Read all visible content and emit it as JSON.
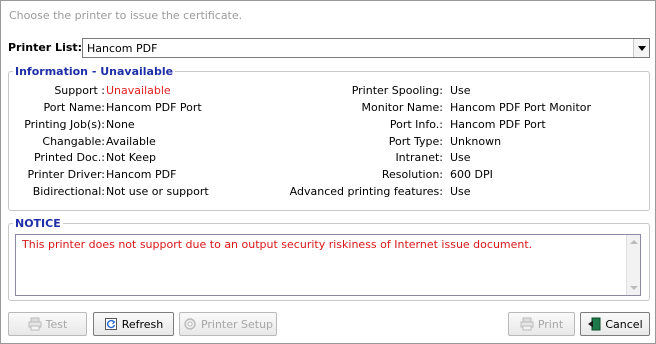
{
  "hint": "Choose the printer to issue the certificate.",
  "printer_list": {
    "label": "Printer List:",
    "selected": "Hancom PDF"
  },
  "information": {
    "legend": "Information - Unavailable",
    "left": [
      {
        "key": "Support :",
        "value": "Unavailable"
      },
      {
        "key": "Port Name:",
        "value": "Hancom PDF Port"
      },
      {
        "key": "Printing Job(s):",
        "value": "None"
      },
      {
        "key": "Changable:",
        "value": "Available"
      },
      {
        "key": "Printed Doc.:",
        "value": "Not Keep"
      },
      {
        "key": "Printer Driver:",
        "value": "Hancom PDF"
      },
      {
        "key": "Bidirectional:",
        "value": "Not use or support"
      }
    ],
    "right": [
      {
        "key": "Printer Spooling:",
        "value": "Use"
      },
      {
        "key": "Monitor Name:",
        "value": "Hancom PDF Port Monitor"
      },
      {
        "key": "Port Info.:",
        "value": "Hancom PDF Port"
      },
      {
        "key": "Port Type:",
        "value": "Unknown"
      },
      {
        "key": "Intranet:",
        "value": "Use"
      },
      {
        "key": "Resolution:",
        "value": "600 DPI"
      },
      {
        "key": "Advanced printing features:",
        "value": "Use"
      }
    ]
  },
  "notice": {
    "legend": "NOTICE",
    "text": "This printer does not support due to an output security riskiness of Internet issue document."
  },
  "buttons": {
    "test": "Test",
    "refresh": "Refresh",
    "printer_setup": "Printer Setup",
    "print": "Print",
    "cancel": "Cancel"
  },
  "colors": {
    "legend": "#1f2fa8",
    "warning": "#e02020",
    "hint": "#9a9a9a"
  }
}
